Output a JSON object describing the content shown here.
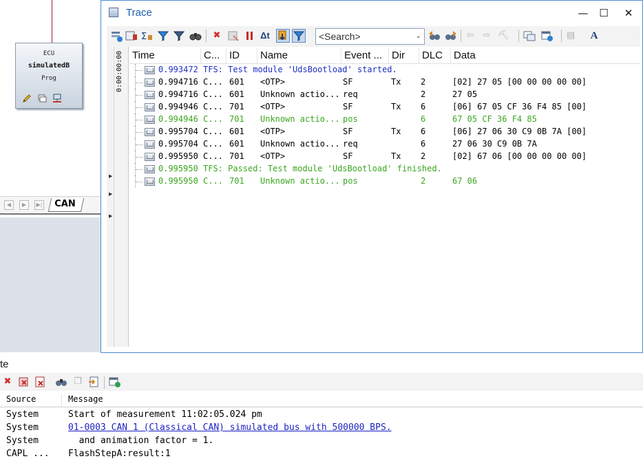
{
  "network": {
    "ecu_type": "ECU",
    "ecu_name": "simulatedB",
    "ecu_mode": "Prog",
    "bus_tab": "CAN"
  },
  "trace": {
    "title": "Trace",
    "search_placeholder": "<Search>",
    "time_ruler": "0:00:00:00",
    "columns": [
      "Time",
      "C...",
      "ID",
      "Name",
      "Event ...",
      "Dir",
      "DLC",
      "Data"
    ],
    "rows": [
      {
        "kind": "text",
        "color": "blue",
        "time": "0.993472",
        "text": "TFS: Test module 'UdsBootload' started."
      },
      {
        "kind": "msg",
        "color": "black",
        "time": "0.994716",
        "chn": "C...",
        "id": "601",
        "name": "<OTP>",
        "event": "SF",
        "dir": "Tx",
        "dlc": "2",
        "data": "[02] 27 05 [00 00 00 00 00]"
      },
      {
        "kind": "msg",
        "color": "black",
        "time": "0.994716",
        "chn": "C...",
        "id": "601",
        "name": "Unknown actio...",
        "event": "req",
        "dir": "",
        "dlc": "2",
        "data": "27 05"
      },
      {
        "kind": "msg",
        "color": "black",
        "time": "0.994946",
        "chn": "C...",
        "id": "701",
        "name": "<OTP>",
        "event": "SF",
        "dir": "Tx",
        "dlc": "6",
        "data": "[06] 67 05 CF 36 F4 85 [00]"
      },
      {
        "kind": "msg",
        "color": "green",
        "time": "0.994946",
        "chn": "C...",
        "id": "701",
        "name": "Unknown actio...",
        "event": "pos",
        "dir": "",
        "dlc": "6",
        "data": "67 05 CF 36 F4 85"
      },
      {
        "kind": "msg",
        "color": "black",
        "time": "0.995704",
        "chn": "C...",
        "id": "601",
        "name": "<OTP>",
        "event": "SF",
        "dir": "Tx",
        "dlc": "6",
        "data": "[06] 27 06 30 C9 0B 7A [00]"
      },
      {
        "kind": "msg",
        "color": "black",
        "time": "0.995704",
        "chn": "C...",
        "id": "601",
        "name": "Unknown actio...",
        "event": "req",
        "dir": "",
        "dlc": "6",
        "data": "27 06 30 C9 0B 7A"
      },
      {
        "kind": "msg",
        "color": "black",
        "time": "0.995950",
        "chn": "C...",
        "id": "701",
        "name": "<OTP>",
        "event": "SF",
        "dir": "Tx",
        "dlc": "2",
        "data": "[02] 67 06 [00 00 00 00 00]"
      },
      {
        "kind": "text",
        "color": "green",
        "time": "0.995950",
        "text": "TFS: Passed: Test module 'UdsBootload' finished."
      },
      {
        "kind": "msg",
        "color": "green",
        "time": "0.995950",
        "chn": "C...",
        "id": "701",
        "name": "Unknown actio...",
        "event": "pos",
        "dir": "",
        "dlc": "2",
        "data": "67 06"
      }
    ]
  },
  "write": {
    "title": "te",
    "columns": [
      "Source",
      "Message"
    ],
    "rows": [
      {
        "source": "System",
        "message": "Start of measurement 11:02:05.024 pm",
        "link": false
      },
      {
        "source": "System",
        "message": "01-0003 CAN 1 (Classical CAN)  simulated bus with 500000 BPS.",
        "link": true
      },
      {
        "source": "System",
        "message": "  and animation factor = 1.",
        "link": false
      },
      {
        "source": "CAPL ...",
        "message": "FlashStepA:result:1",
        "link": false
      }
    ]
  },
  "colors": {
    "blue_text": "#1f2fc4",
    "green_text": "#3aa61f",
    "title_blue": "#1a5ca8",
    "link_blue": "#1a1fc0"
  },
  "icons": {
    "trace_toolbar": [
      "filter-add-icon",
      "columns-icon",
      "sort-icon",
      "filter-icon",
      "filter-clear-icon",
      "find-icon",
      "delete-icon",
      "clear-icon",
      "pause-icon",
      "time-mode-icon",
      "scroll-lock-icon",
      "detail-view-icon",
      "search-prev-icon",
      "search-next-icon",
      "back-icon",
      "forward-icon",
      "marker-icon",
      "copy-window-icon",
      "layout-icon",
      "columns-menu-icon",
      "font-size-icon"
    ],
    "write_toolbar": [
      "delete-icon",
      "clear-icon",
      "clear-all-icon",
      "find-icon",
      "copy-icon",
      "export-icon",
      "settings-icon"
    ]
  }
}
